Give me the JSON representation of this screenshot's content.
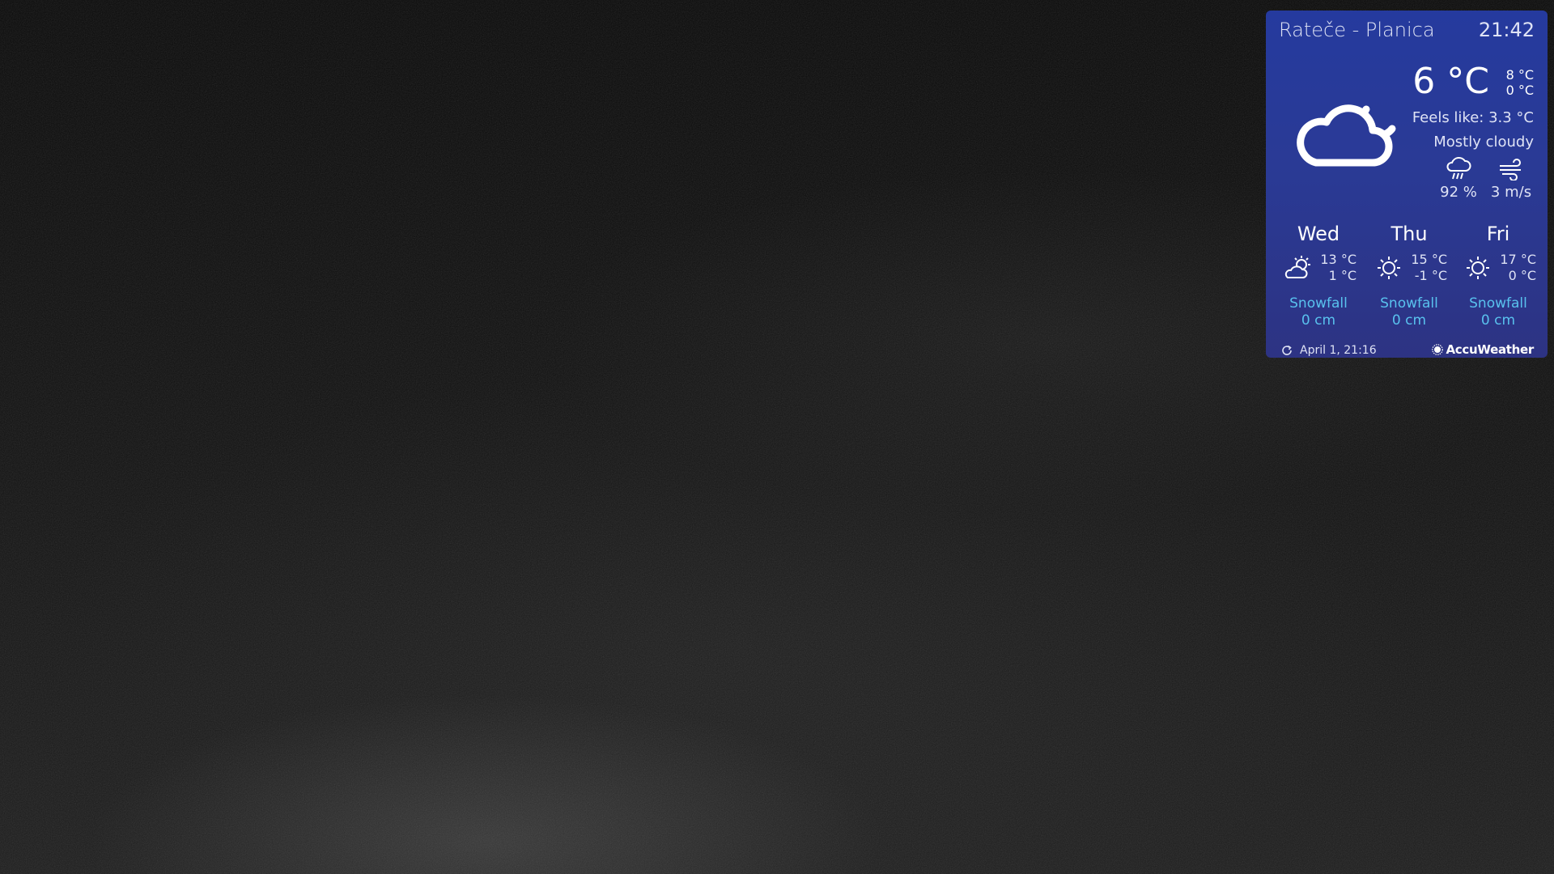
{
  "widget": {
    "location": "Rateče - Planica",
    "time": "21:42",
    "current": {
      "icon": "cloud-moon-icon",
      "temperature": "6 °C",
      "high": "8 °C",
      "low": "0 °C",
      "feels_like": "Feels like: 3.3 °C",
      "condition": "Mostly cloudy",
      "precipitation_icon": "rain-cloud-icon",
      "precipitation": "92 %",
      "wind_icon": "wind-icon",
      "wind": "3 m/s"
    },
    "forecast": [
      {
        "day": "Wed",
        "icon": "partly-cloudy-icon",
        "high": "13 °C",
        "low": "1 °C",
        "snow_label": "Snowfall",
        "snow_value": "0 cm"
      },
      {
        "day": "Thu",
        "icon": "sun-icon",
        "high": "15 °C",
        "low": "-1 °C",
        "snow_label": "Snowfall",
        "snow_value": "0 cm"
      },
      {
        "day": "Fri",
        "icon": "sun-icon",
        "high": "17 °C",
        "low": "0 °C",
        "snow_label": "Snowfall",
        "snow_value": "0 cm"
      }
    ],
    "updated": "April 1, 21:16",
    "brand": "AccuWeather",
    "colors": {
      "panel": "#2a3a95",
      "snow_text": "#59c2ee",
      "text": "#ffffff"
    }
  }
}
